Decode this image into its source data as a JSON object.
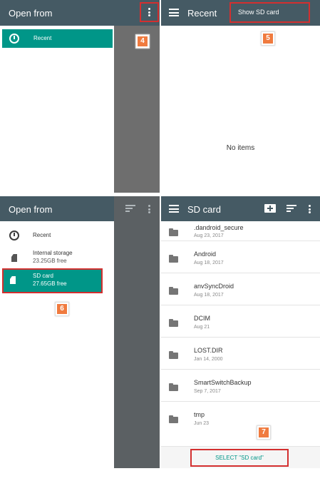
{
  "top_left": {
    "title": "Open from",
    "recent": "Recent",
    "badge": "4"
  },
  "top_right": {
    "title": "Recent",
    "menu_item": "Show SD card",
    "empty": "No items",
    "badge": "5"
  },
  "bottom_left": {
    "title": "Open from",
    "items": [
      {
        "label": "Recent"
      },
      {
        "label": "Internal storage",
        "sub": "23.25GB free"
      },
      {
        "label": "SD card",
        "sub": "27.65GB free"
      }
    ],
    "badge": "6"
  },
  "bottom_right": {
    "title": "SD card",
    "folders": [
      {
        "name": ".dandroid_secure",
        "date": "Aug 23, 2017"
      },
      {
        "name": "Android",
        "date": "Aug 18, 2017"
      },
      {
        "name": "anvSyncDroid",
        "date": "Aug 18, 2017"
      },
      {
        "name": "DCIM",
        "date": "Aug 21"
      },
      {
        "name": "LOST.DIR",
        "date": "Jan 14, 2000"
      },
      {
        "name": "SmartSwitchBackup",
        "date": "Sep 7, 2017"
      },
      {
        "name": "tmp",
        "date": "Jun 23"
      }
    ],
    "select_button": "SELECT \"SD card\"",
    "badge": "7"
  },
  "colors": {
    "toolbar": "#455a64",
    "selected": "#009688",
    "highlight": "#d32f2f",
    "badge": "#f07b3f"
  }
}
